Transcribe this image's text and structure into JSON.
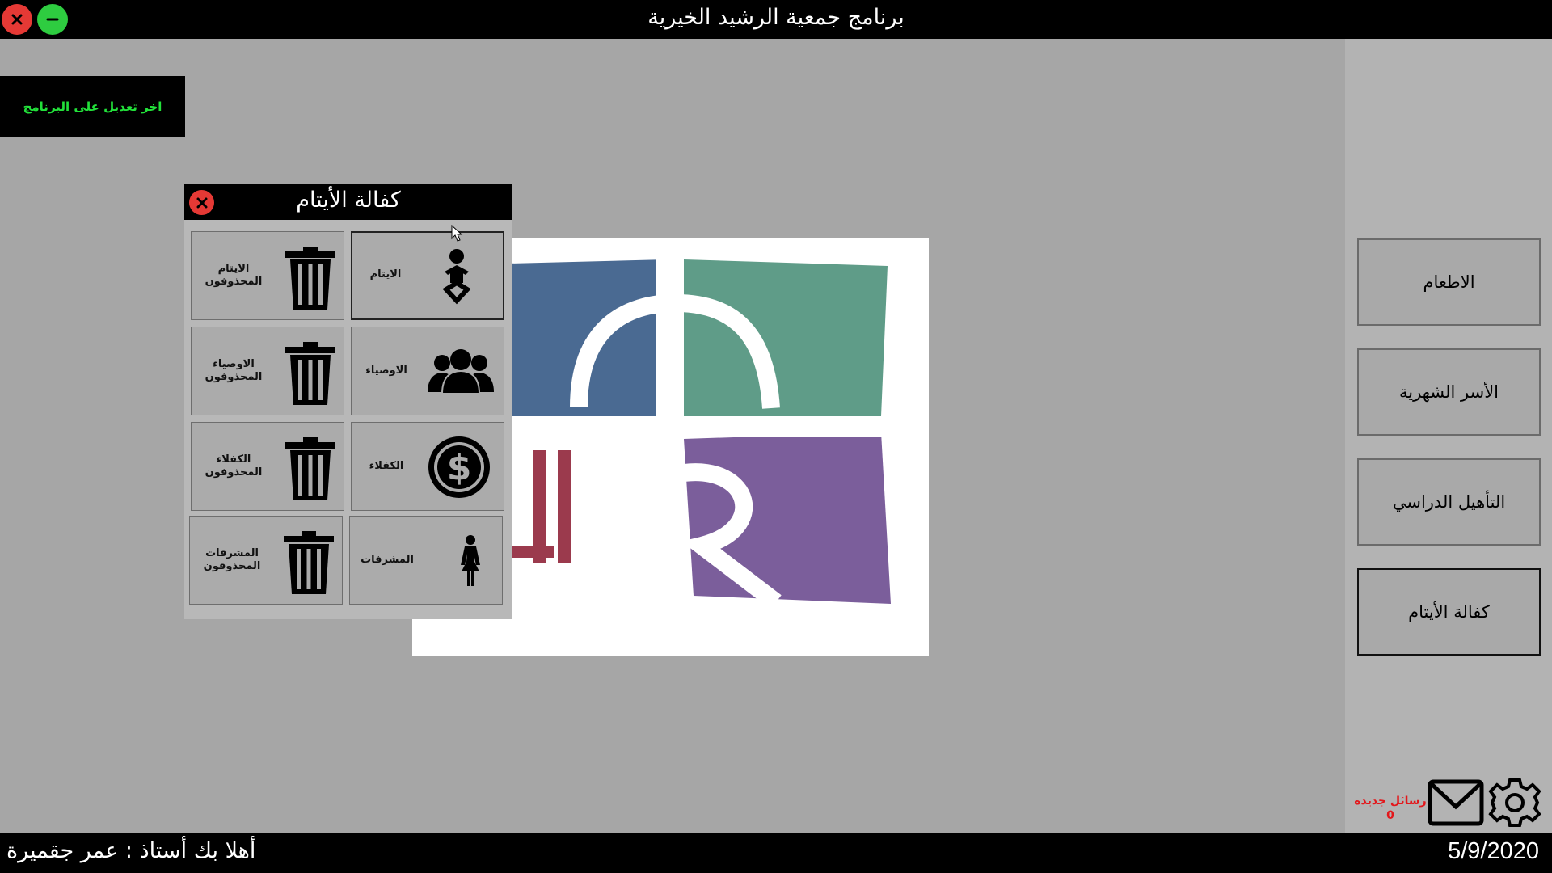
{
  "window": {
    "title": "برنامج جمعية الرشيد الخيرية",
    "close_icon": "close-icon",
    "minimize_icon": "minimize-icon"
  },
  "last_update_label": "اخر تعديل على البرنامج",
  "nav": {
    "items": [
      {
        "label": "الاطعام"
      },
      {
        "label": "الأسر الشهرية"
      },
      {
        "label": "التأهيل الدراسي"
      },
      {
        "label": "كفالة الأيتام",
        "active": true
      }
    ]
  },
  "logo": {
    "text": "الرشيد",
    "colors": {
      "blue": "#4a6a92",
      "green": "#5f9c88",
      "purple": "#7b5e9b",
      "maroon": "#9b3a4d"
    }
  },
  "popup": {
    "title": "كفالة الأيتام",
    "tiles": [
      {
        "label": "الايتام",
        "icon": "baby-icon"
      },
      {
        "label": "الايتام المحذوفون",
        "icon": "trash-icon"
      },
      {
        "label": "الاوصياء",
        "icon": "group-icon"
      },
      {
        "label": "الاوصياء المحذوفون",
        "icon": "trash-icon"
      },
      {
        "label": "الكفلاء",
        "icon": "dollar-icon"
      },
      {
        "label": "الكفلاء المحذوفون",
        "icon": "trash-icon"
      },
      {
        "label": "المشرفات",
        "icon": "woman-icon"
      },
      {
        "label": "المشرفات المحذوفون",
        "icon": "trash-icon"
      }
    ]
  },
  "messages": {
    "label": "رسائل جديدة",
    "count": "0"
  },
  "status": {
    "welcome": "أهلا بك أستاذ : عمر جقميرة",
    "date": "5/9/2020"
  },
  "colors": {
    "background": "#a6a6a6",
    "bar": "#000000",
    "accent_green": "#22e13a",
    "alert_red": "#e3171b"
  }
}
